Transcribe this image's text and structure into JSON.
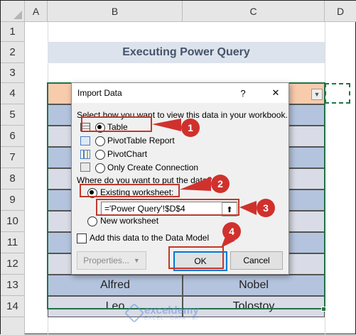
{
  "columns": [
    "A",
    "B",
    "C",
    "D"
  ],
  "rows": [
    "1",
    "2",
    "3",
    "4",
    "5",
    "6",
    "7",
    "8",
    "9",
    "10",
    "11",
    "12",
    "13",
    "14"
  ],
  "sheet_title": "Executing Power Query",
  "table_rows": [
    {
      "b": "Alfred",
      "c": "Nobel"
    },
    {
      "b": "Leo",
      "c": "Tolostoy"
    }
  ],
  "dialog": {
    "title": "Import Data",
    "help": "?",
    "close": "✕",
    "view_prompt": "Select how you want to view this data in your workbook.",
    "view_options": [
      {
        "label": "Table",
        "selected": true
      },
      {
        "label": "PivotTable Report",
        "selected": false
      },
      {
        "label": "PivotChart",
        "selected": false
      },
      {
        "label": "Only Create Connection",
        "selected": false
      }
    ],
    "location_prompt": "Where do you want to put the data?",
    "existing_label": "Existing worksheet:",
    "existing_selected": true,
    "range_value": "='Power Query'!$D$4",
    "new_label": "New worksheet",
    "data_model_label": "Add this data to the Data Model",
    "data_model_checked": false,
    "properties_label": "Properties...",
    "ok_label": "OK",
    "cancel_label": "Cancel"
  },
  "callouts": [
    "1",
    "2",
    "3",
    "4"
  ],
  "watermark": {
    "name": "exceldemy",
    "tagline": "EXCEL · DATA · BI"
  },
  "colors": {
    "callout_red": "#d0312d",
    "table_blue": "#b4c4de",
    "header_peach": "#f8cbad",
    "title_band": "#dde3ec"
  }
}
